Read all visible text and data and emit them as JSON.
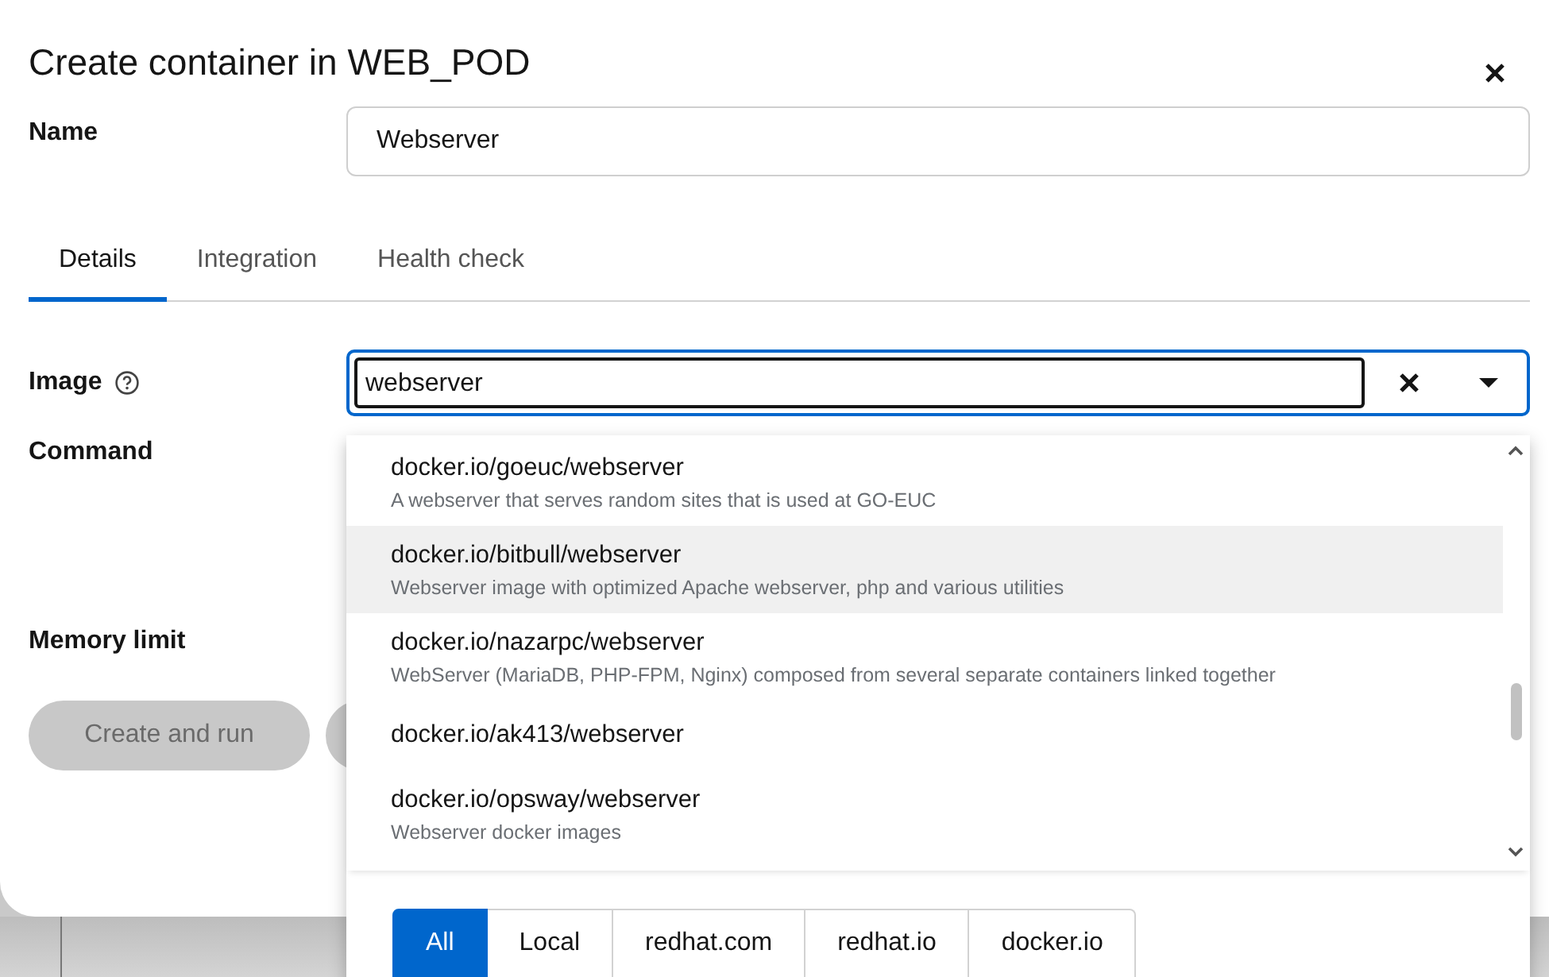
{
  "dialog": {
    "title": "Create container in WEB_POD"
  },
  "name_field": {
    "label": "Name",
    "value": "Webserver"
  },
  "tabs": [
    {
      "label": "Details",
      "selected": true
    },
    {
      "label": "Integration",
      "selected": false
    },
    {
      "label": "Health check",
      "selected": false
    }
  ],
  "image_field": {
    "label": "Image",
    "value": "webserver"
  },
  "command_field": {
    "label": "Command"
  },
  "memory_field": {
    "label": "Memory limit"
  },
  "buttons": [
    {
      "label": "Create and run",
      "disabled": true
    }
  ],
  "image_options": [
    {
      "name": "docker.io/goeuc/webserver",
      "description": "A webserver that serves random sites that is used at GO-EUC",
      "selected": false
    },
    {
      "name": "docker.io/bitbull/webserver",
      "description": "Webserver image with optimized Apache webserver, php and various utilities",
      "selected": true
    },
    {
      "name": "docker.io/nazarpc/webserver",
      "description": "WebServer (MariaDB, PHP-FPM, Nginx) composed from several separate containers linked together",
      "selected": false
    },
    {
      "name": "docker.io/ak413/webserver",
      "selected": false
    },
    {
      "name": "docker.io/opsway/webserver",
      "description": "Webserver docker images",
      "selected": false
    }
  ],
  "registry_filters": [
    {
      "label": "All",
      "selected": true
    },
    {
      "label": "Local",
      "selected": false
    },
    {
      "label": "redhat.com",
      "selected": false
    },
    {
      "label": "redhat.io",
      "selected": false
    },
    {
      "label": "docker.io",
      "selected": false
    }
  ]
}
